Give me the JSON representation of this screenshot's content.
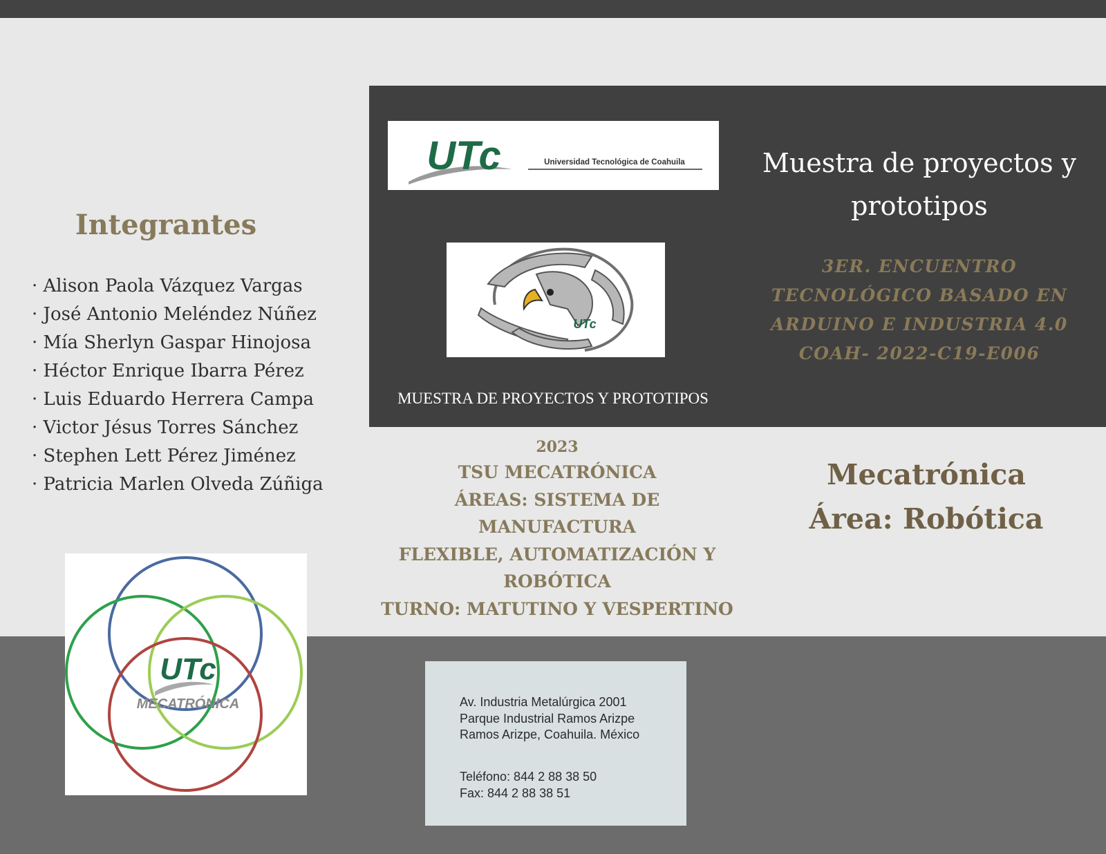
{
  "members": {
    "heading": "Integrantes",
    "list": [
      "· Alison Paola Vázquez Vargas",
      "· José Antonio Meléndez Núñez",
      "· Mía Sherlyn Gaspar Hinojosa",
      "· Héctor Enrique Ibarra Pérez",
      "· Luis Eduardo Herrera Campa",
      "· Victor Jésus Torres Sánchez",
      "· Stephen Lett Pérez Jiménez",
      "· Patricia Marlen Olveda Zúñiga"
    ]
  },
  "utc_banner": {
    "logo_text": "UTc",
    "university_name": "Universidad Tecnológica de Coahuila"
  },
  "eagle_logo": {
    "icon": "eagle-gear-logo",
    "logo_text": "UTc"
  },
  "panel_caption": "MUESTRA DE PROYECTOS Y PROTOTIPOS",
  "event": {
    "title_line1": "Muestra de proyectos y",
    "title_line2": "prototipos",
    "sub_lines": [
      "3ER. ENCUENTRO",
      "TECNOLÓGICO BASADO EN",
      "ARDUINO E INDUSTRIA 4.0",
      "COAH- 2022-C19-E006"
    ]
  },
  "program": {
    "year": "2023",
    "lines": [
      "TSU MECATRÓNICA",
      "ÁREAS: SISTEMA DE MANUFACTURA",
      "FLEXIBLE, AUTOMATIZACIÓN Y",
      "ROBÓTICA",
      "TURNO: MATUTINO Y VESPERTINO"
    ]
  },
  "area": {
    "line1": "Mecatrónica",
    "line2": "Área: Robótica"
  },
  "mecatronica_logo": {
    "logo_text": "UTc",
    "caption": "MECATRÓNICA",
    "ring_colors": [
      "#4a6aa0",
      "#2ea04a",
      "#9ccc55",
      "#b0443f"
    ]
  },
  "contact": {
    "address_lines": [
      "Av. Industria Metalúrgica 2001",
      "Parque Industrial Ramos Arizpe",
      "Ramos Arizpe, Coahuila. México"
    ],
    "phone": "Teléfono: 844 2 88 38 50",
    "fax": "Fax: 844 2 88 38 51"
  },
  "colors": {
    "gold": "#877a5b",
    "dark_panel": "#404040",
    "utc_green": "#1e6b47"
  }
}
